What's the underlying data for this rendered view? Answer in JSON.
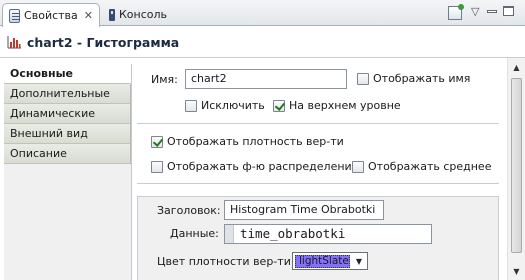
{
  "tabs": [
    {
      "label": "Свойства",
      "active": true,
      "icon": "properties-icon"
    },
    {
      "label": "Консоль",
      "active": false,
      "icon": "console-icon"
    }
  ],
  "header": {
    "title": "chart2 - Гистограмма",
    "icon": "histogram-icon"
  },
  "nav": {
    "items": [
      {
        "label": "Основные",
        "active": true
      },
      {
        "label": "Дополнительные",
        "active": false
      },
      {
        "label": "Динамические",
        "active": false
      },
      {
        "label": "Внешний вид",
        "active": false
      },
      {
        "label": "Описание",
        "active": false
      }
    ]
  },
  "general": {
    "name_label": "Имя:",
    "name_value": "chart2",
    "show_name_label": "Отображать имя",
    "show_name_checked": false,
    "exclude_label": "Исключить",
    "exclude_checked": false,
    "top_level_label": "На верхнем уровне",
    "top_level_checked": true
  },
  "display": {
    "show_density_label": "Отображать плотность вер-ти",
    "show_density_checked": true,
    "show_distribution_label": "Отображать ф-ю распределения",
    "show_distribution_checked": false,
    "show_mean_label": "Отображать среднее",
    "show_mean_checked": false
  },
  "data_panel": {
    "title_label": "Заголовок:",
    "title_value": "Histogram Time Obrabotki",
    "data_label": "Данные:",
    "data_value": "time_obrabotki",
    "density_color_label": "Цвет плотности вер-ти:",
    "density_color_value": "lightSlateBlue",
    "density_color_hex": "#8470ff"
  }
}
